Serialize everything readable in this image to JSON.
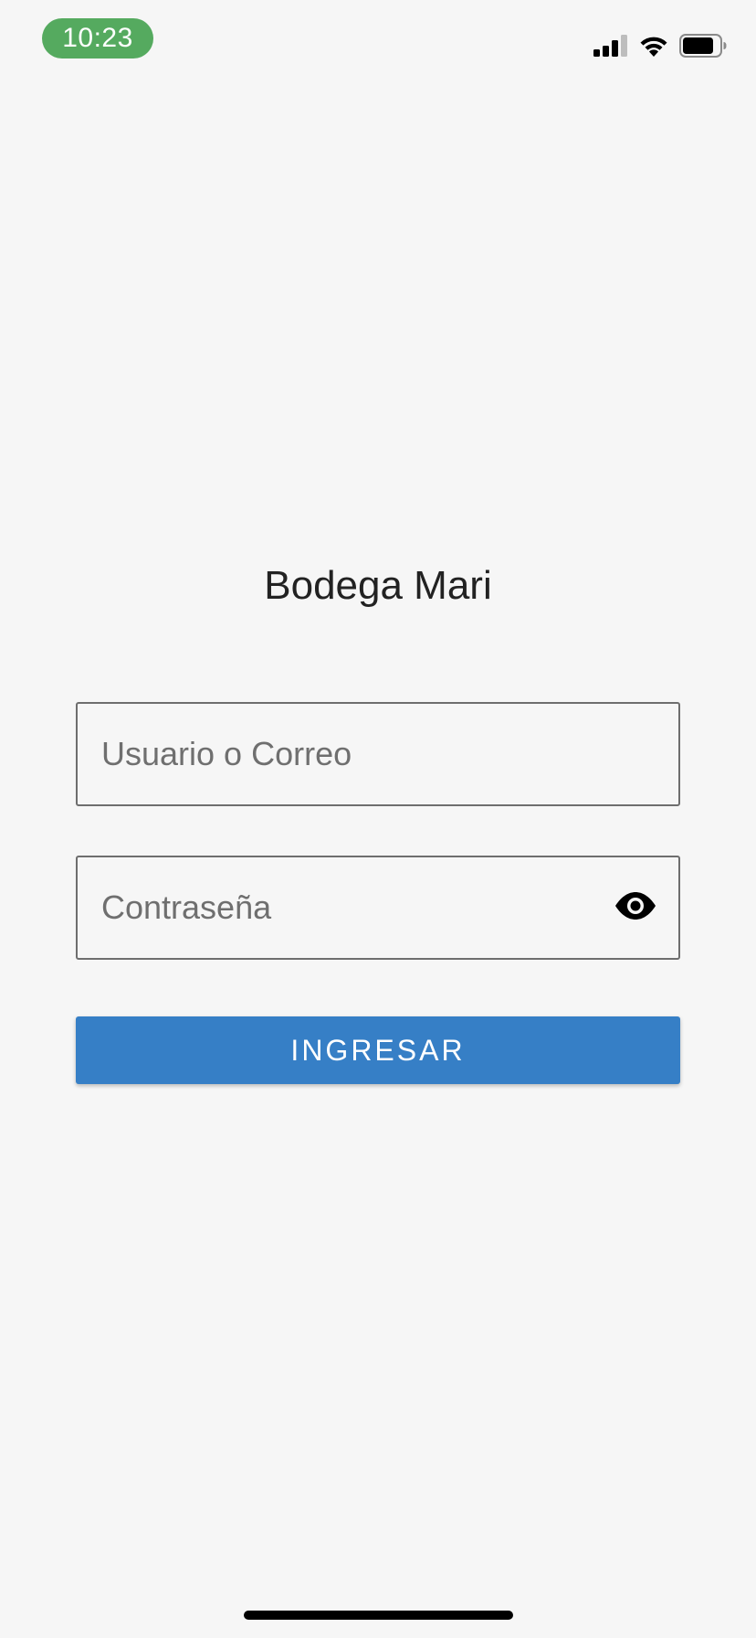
{
  "status_bar": {
    "time": "10:23",
    "time_pill_color": "#55aa5f",
    "icons": [
      "cellular-signal-icon",
      "wifi-icon",
      "battery-icon"
    ]
  },
  "app": {
    "title": "Bodega Mari"
  },
  "login_form": {
    "username_placeholder": "Usuario o Correo",
    "username_value": "",
    "password_placeholder": "Contraseña",
    "password_value": "",
    "password_toggle_icon": "eye-icon",
    "submit_label": "INGRESAR",
    "submit_color": "#367fc6"
  }
}
